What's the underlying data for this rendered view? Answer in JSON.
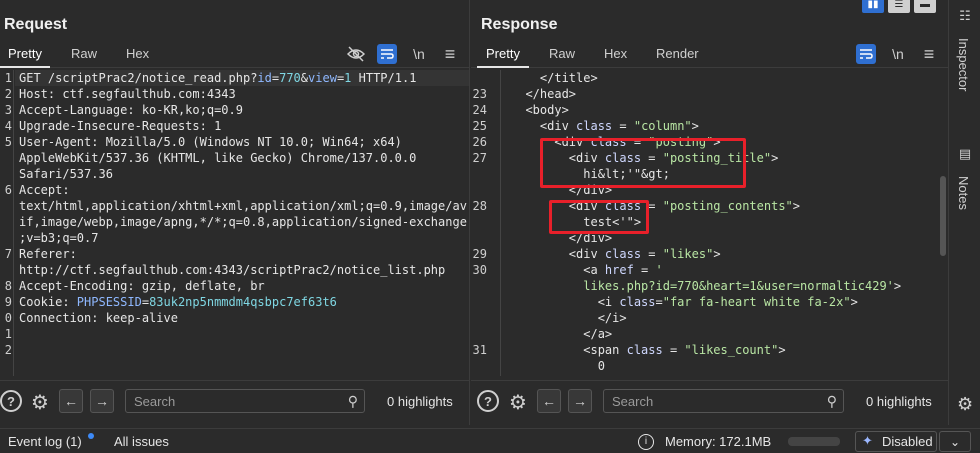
{
  "request": {
    "title": "Request",
    "tabs": [
      "Pretty",
      "Raw",
      "Hex"
    ],
    "tool_labels": {
      "newline": "\\n",
      "menu": "≡"
    },
    "line_numbers": [
      "1",
      "2",
      "3",
      "4",
      "5",
      "",
      "",
      "6",
      "",
      "",
      "",
      "7",
      "",
      "8",
      "9",
      "0",
      "1",
      "2"
    ],
    "lines": [
      [
        {
          "t": "GET /scriptPrac2/notice_read.php?",
          "c": "tk-key"
        },
        {
          "t": "id",
          "c": "tk-blue"
        },
        {
          "t": "=",
          "c": "tk-key"
        },
        {
          "t": "770",
          "c": "tk-cyan"
        },
        {
          "t": "&",
          "c": "tk-key"
        },
        {
          "t": "view",
          "c": "tk-blue"
        },
        {
          "t": "=",
          "c": "tk-key"
        },
        {
          "t": "1",
          "c": "tk-cyan"
        },
        {
          "t": " HTTP/1.1",
          "c": "tk-key"
        }
      ],
      [
        {
          "t": "Host: ctf.segfaulthub.com:4343",
          "c": "tk-key"
        }
      ],
      [
        {
          "t": "Accept-Language: ko-KR,ko;q=0.9",
          "c": "tk-key"
        }
      ],
      [
        {
          "t": "Upgrade-Insecure-Requests: 1",
          "c": "tk-key"
        }
      ],
      [
        {
          "t": "User-Agent: Mozilla/5.0 (Windows NT 10.0; Win64; x64)",
          "c": "tk-key"
        }
      ],
      [
        {
          "t": "AppleWebKit/537.36 (KHTML, like Gecko) Chrome/137.0.0.0",
          "c": "tk-key"
        }
      ],
      [
        {
          "t": "Safari/537.36",
          "c": "tk-key"
        }
      ],
      [
        {
          "t": "Accept:",
          "c": "tk-key"
        }
      ],
      [
        {
          "t": "text/html,application/xhtml+xml,application/xml;q=0.9,image/av",
          "c": "tk-key"
        }
      ],
      [
        {
          "t": "if,image/webp,image/apng,*/*;q=0.8,application/signed-exchange",
          "c": "tk-key"
        }
      ],
      [
        {
          "t": ";v=b3;q=0.7",
          "c": "tk-key"
        }
      ],
      [
        {
          "t": "Referer:",
          "c": "tk-key"
        }
      ],
      [
        {
          "t": "http://ctf.segfaulthub.com:4343/scriptPrac2/notice_list.php",
          "c": "tk-key"
        }
      ],
      [
        {
          "t": "Accept-Encoding: gzip, deflate, br",
          "c": "tk-key"
        }
      ],
      [
        {
          "t": "Cookie: ",
          "c": "tk-key"
        },
        {
          "t": "PHPSESSID",
          "c": "tk-blue"
        },
        {
          "t": "=",
          "c": "tk-key"
        },
        {
          "t": "83uk2np5nmmdm4qsbpc7ef63t6",
          "c": "tk-cyan"
        }
      ],
      [
        {
          "t": "Connection: keep-alive",
          "c": "tk-key"
        }
      ],
      [],
      []
    ],
    "search_placeholder": "Search",
    "highlights": "0 highlights"
  },
  "response": {
    "title": "Response",
    "tabs": [
      "Pretty",
      "Raw",
      "Hex",
      "Render"
    ],
    "tool_labels": {
      "newline": "\\n",
      "menu": "≡"
    },
    "line_numbers": [
      "",
      "23",
      "24",
      "25",
      "26",
      "27",
      "",
      "",
      "28",
      "",
      "",
      "29",
      "30",
      "",
      "",
      "",
      "",
      "31",
      "",
      ""
    ],
    "lines": [
      [
        {
          "t": "    </title>",
          "c": "tk-key"
        }
      ],
      [
        {
          "t": "  </head>",
          "c": "tk-key"
        }
      ],
      [
        {
          "t": "  <body>",
          "c": "tk-key"
        }
      ],
      [
        {
          "t": "    <div ",
          "c": "tk-key"
        },
        {
          "t": "class",
          "c": "tk-attr"
        },
        {
          "t": " = ",
          "c": "tk-key"
        },
        {
          "t": "\"column\"",
          "c": "tk-str"
        },
        {
          "t": ">",
          "c": "tk-key"
        }
      ],
      [
        {
          "t": "      <div ",
          "c": "tk-key"
        },
        {
          "t": "class",
          "c": "tk-attr"
        },
        {
          "t": " = ",
          "c": "tk-key"
        },
        {
          "t": "\"posting\"",
          "c": "tk-str"
        },
        {
          "t": ">",
          "c": "tk-key"
        }
      ],
      [
        {
          "t": "        <div ",
          "c": "tk-key"
        },
        {
          "t": "class",
          "c": "tk-attr"
        },
        {
          "t": " = ",
          "c": "tk-key"
        },
        {
          "t": "\"posting_title\"",
          "c": "tk-str"
        },
        {
          "t": ">",
          "c": "tk-key"
        }
      ],
      [
        {
          "t": "          hi&lt;'\"&gt;",
          "c": "tk-key"
        }
      ],
      [
        {
          "t": "        </div>",
          "c": "tk-key"
        }
      ],
      [
        {
          "t": "        <div ",
          "c": "tk-key"
        },
        {
          "t": "class",
          "c": "tk-attr"
        },
        {
          "t": " = ",
          "c": "tk-key"
        },
        {
          "t": "\"posting_contents\"",
          "c": "tk-str"
        },
        {
          "t": ">",
          "c": "tk-key"
        }
      ],
      [
        {
          "t": "          test<'\">",
          "c": "tk-key"
        }
      ],
      [
        {
          "t": "        </div>",
          "c": "tk-key"
        }
      ],
      [
        {
          "t": "        <div ",
          "c": "tk-key"
        },
        {
          "t": "class",
          "c": "tk-attr"
        },
        {
          "t": " = ",
          "c": "tk-key"
        },
        {
          "t": "\"likes\"",
          "c": "tk-str"
        },
        {
          "t": ">",
          "c": "tk-key"
        }
      ],
      [
        {
          "t": "          <a ",
          "c": "tk-key"
        },
        {
          "t": "href",
          "c": "tk-attr"
        },
        {
          "t": " = ",
          "c": "tk-key"
        },
        {
          "t": "'",
          "c": "tk-str"
        }
      ],
      [
        {
          "t": "          likes.php?id=770&heart=1&user=normaltic429'",
          "c": "tk-str"
        },
        {
          "t": ">",
          "c": "tk-key"
        }
      ],
      [
        {
          "t": "            <i ",
          "c": "tk-key"
        },
        {
          "t": "class",
          "c": "tk-attr"
        },
        {
          "t": "=",
          "c": "tk-key"
        },
        {
          "t": "\"far fa-heart white fa-2x\"",
          "c": "tk-str"
        },
        {
          "t": ">",
          "c": "tk-key"
        }
      ],
      [
        {
          "t": "            </i>",
          "c": "tk-key"
        }
      ],
      [
        {
          "t": "          </a>",
          "c": "tk-key"
        }
      ],
      [
        {
          "t": "          <span ",
          "c": "tk-key"
        },
        {
          "t": "class",
          "c": "tk-attr"
        },
        {
          "t": " = ",
          "c": "tk-key"
        },
        {
          "t": "\"likes_count\"",
          "c": "tk-str"
        },
        {
          "t": ">",
          "c": "tk-key"
        }
      ],
      [
        {
          "t": "            0",
          "c": "tk-key"
        }
      ],
      [
        {
          "t": "          </span>",
          "c": "tk-key"
        }
      ]
    ],
    "search_placeholder": "Search",
    "highlights": "0 highlights"
  },
  "side": {
    "inspector_label": "Inspector",
    "notes_label": "Notes"
  },
  "status": {
    "event_log": "Event log (1)",
    "all_issues": "All issues",
    "memory": "Memory: 172.1MB",
    "disabled": "Disabled"
  },
  "colors": {
    "highlight_box": "#e8202a",
    "accent": "#2f6fd1"
  }
}
